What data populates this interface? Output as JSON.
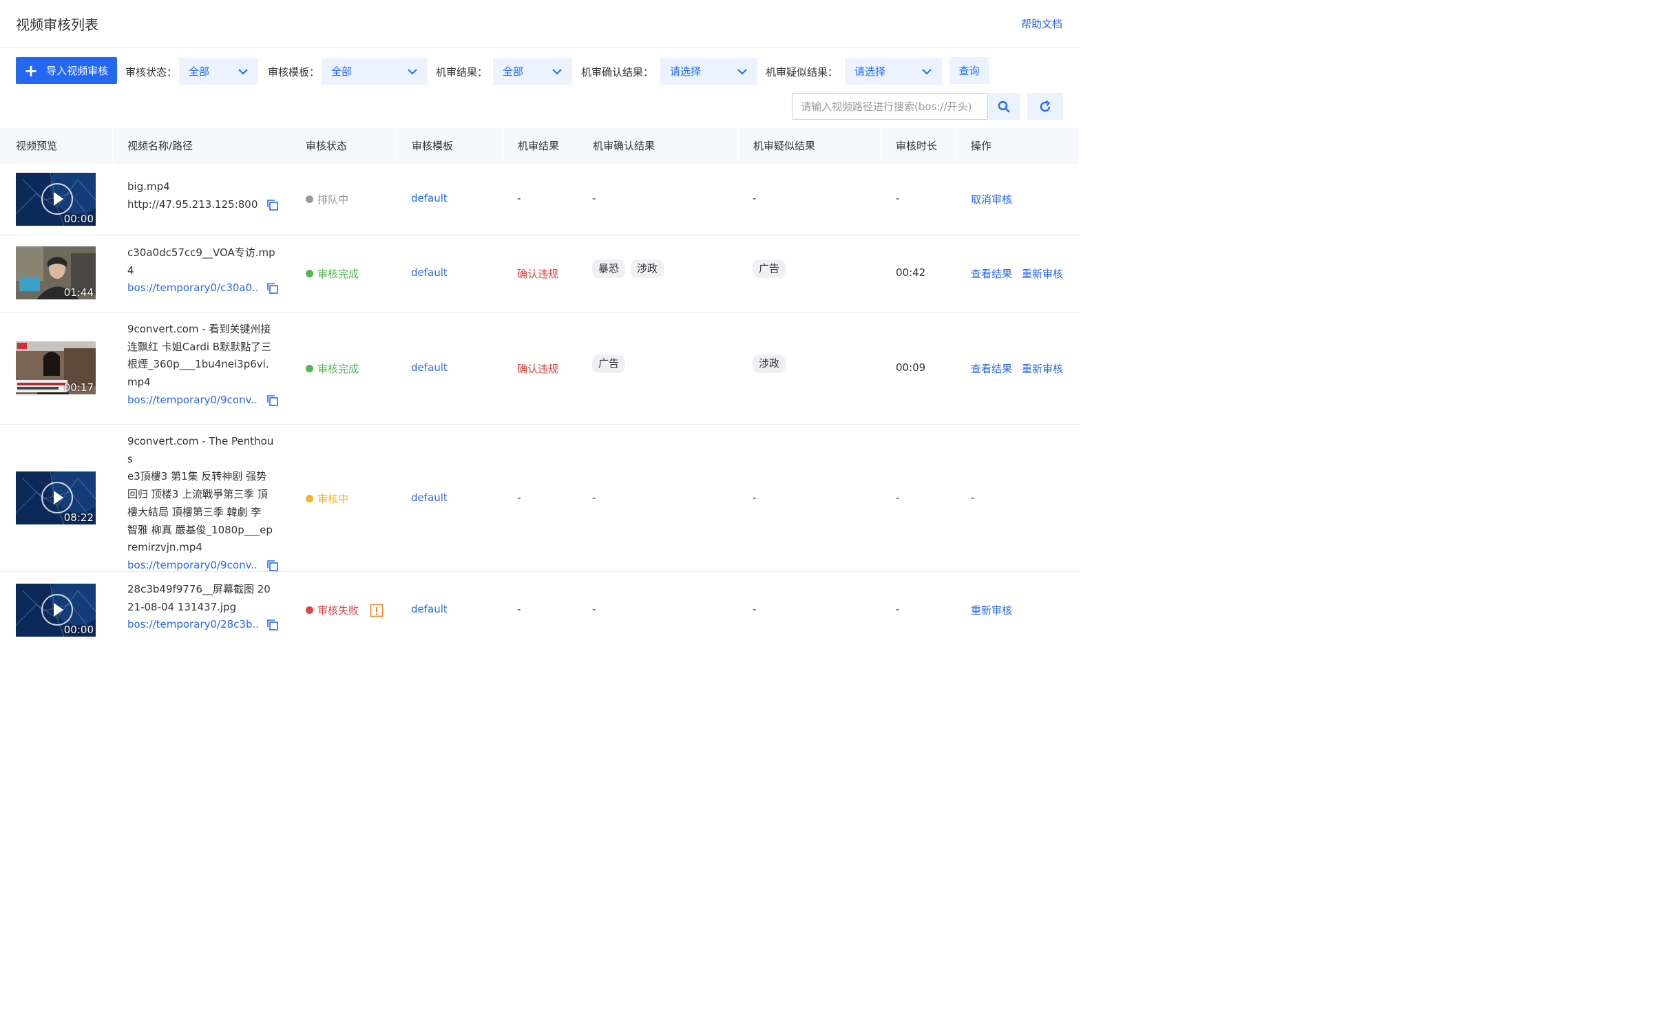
{
  "header": {
    "title": "视频审核列表",
    "help": "帮助文档"
  },
  "toolbar": {
    "import_label": "导入视频审核",
    "filters": [
      {
        "label": "审核状态：",
        "value": "全部"
      },
      {
        "label": "审核模板：",
        "value": "全部"
      },
      {
        "label": "机审结果：",
        "value": "全部"
      },
      {
        "label": "机审确认结果：",
        "value": "请选择"
      },
      {
        "label": "机审疑似结果：",
        "value": "请选择"
      }
    ],
    "query_label": "查询",
    "search_placeholder": "请输入视频路径进行搜索(bos://开头)"
  },
  "table": {
    "columns": [
      "视频预览",
      "视频名称/路径",
      "审核状态",
      "审核模板",
      "机审结果",
      "机审确认结果",
      "机审疑似结果",
      "审核时长",
      "操作"
    ],
    "rows": [
      {
        "thumb": "network",
        "duration": "00:00",
        "name_lines": [
          "big.mp4"
        ],
        "path": "http://47.95.213.125:800...",
        "status": "排队中",
        "status_color": "#999999",
        "template": "default",
        "machine_result": "-",
        "confirm_tags": [],
        "confirm_text": "-",
        "similar_tags": [],
        "similar_text": "-",
        "review_duration": "-",
        "actions": [
          "取消审核"
        ]
      },
      {
        "thumb": "person",
        "duration": "01:44",
        "name_lines": [
          "c30a0dc57cc9__VOA专访.mp",
          "4"
        ],
        "path": "bos://temporary0/c30a0...",
        "status": "审核完成",
        "status_color": "#52b552",
        "template": "default",
        "machine_result": "确认违规",
        "confirm_tags": [
          "暴恐",
          "涉政"
        ],
        "similar_tags": [
          "广告"
        ],
        "review_duration": "00:42",
        "actions": [
          "查看结果",
          "重新审核"
        ]
      },
      {
        "thumb": "news",
        "duration": "00:17",
        "name_lines": [
          "9convert.com - 看到关键州接",
          "连飘红 卡姐Cardi B默默點了三",
          "根煙_360p___1bu4nei3p6vi.",
          "mp4"
        ],
        "path": "bos://temporary0/9conv...",
        "status": "审核完成",
        "status_color": "#52b552",
        "template": "default",
        "machine_result": "确认违规",
        "confirm_tags": [
          "广告"
        ],
        "similar_tags": [
          "涉政"
        ],
        "review_duration": "00:09",
        "actions": [
          "查看结果",
          "重新审核"
        ]
      },
      {
        "thumb": "network",
        "duration": "08:22",
        "name_lines": [
          "9convert.com - The Penthous",
          "e3頂樓3 第1集 反转神剧 强势",
          "回归 顶楼3 上流戰爭第三季 頂",
          "樓大結局 頂樓第三季 韓劇 李",
          "智雅 柳真 嚴基俊_1080p___ep",
          "remirzvjn.mp4"
        ],
        "path": "bos://temporary0/9conv...",
        "status": "审核中",
        "status_color": "#f0b429",
        "template": "default",
        "machine_result": "-",
        "confirm_tags": [],
        "confirm_text": "-",
        "similar_tags": [],
        "similar_text": "-",
        "review_duration": "-",
        "actions_text": "-",
        "actions": []
      },
      {
        "thumb": "network",
        "duration": "00:00",
        "name_lines": [
          "28c3b49f9776__屏幕截图 20",
          "21-08-04 131437.jpg"
        ],
        "path": "bos://temporary0/28c3b...",
        "status": "审核失败",
        "status_color": "#e0443d",
        "status_warn": true,
        "template": "default",
        "machine_result": "-",
        "confirm_tags": [],
        "confirm_text": "-",
        "similar_tags": [],
        "similar_text": "-",
        "review_duration": "-",
        "actions": [
          "重新审核"
        ]
      }
    ]
  },
  "colors": {
    "accent": "#2468f2",
    "select_bg": "#eaf3ff",
    "header_bg": "#f5f7fb",
    "violation": "#e0443d"
  }
}
